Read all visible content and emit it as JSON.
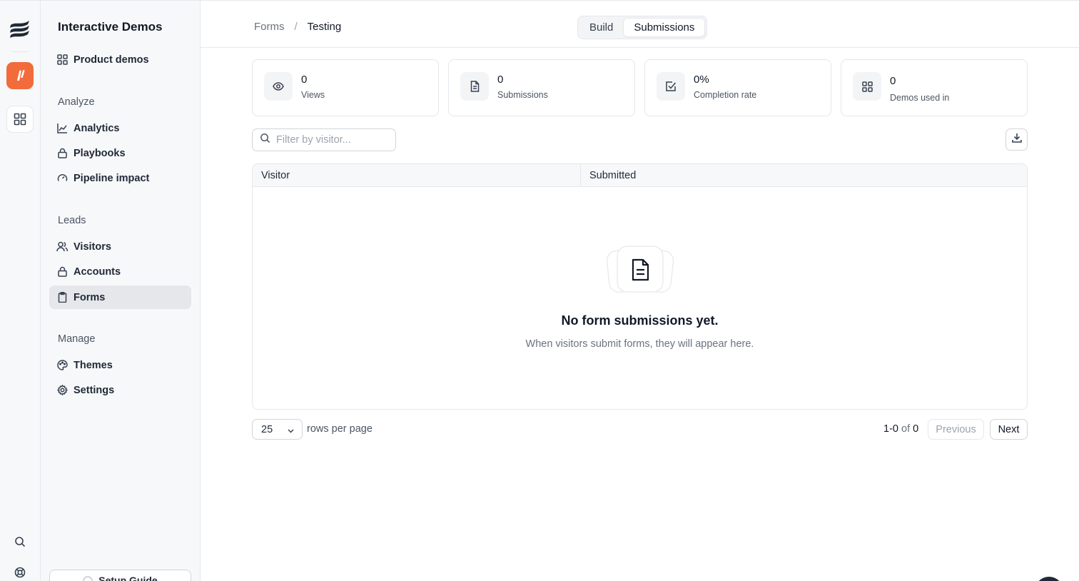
{
  "sidebar": {
    "title": "Interactive Demos",
    "product_demos": "Product demos",
    "sections": {
      "analyze": "Analyze",
      "leads": "Leads",
      "manage": "Manage"
    },
    "items": {
      "analytics": "Analytics",
      "playbooks": "Playbooks",
      "pipeline_impact": "Pipeline impact",
      "visitors": "Visitors",
      "accounts": "Accounts",
      "forms": "Forms",
      "themes": "Themes",
      "settings": "Settings"
    },
    "setup_guide": "Setup Guide"
  },
  "header": {
    "breadcrumb_parent": "Forms",
    "breadcrumb_separator": "/",
    "breadcrumb_current": "Testing",
    "tabs": {
      "build": "Build",
      "submissions": "Submissions"
    },
    "active_tab": "Submissions"
  },
  "stats": [
    {
      "value": "0",
      "label": "Views",
      "icon": "eye-icon"
    },
    {
      "value": "0",
      "label": "Submissions",
      "icon": "document-icon"
    },
    {
      "value": "0%",
      "label": "Completion rate",
      "icon": "check-square-icon"
    },
    {
      "value": "0",
      "label": "Demos used in",
      "icon": "grid-icon"
    }
  ],
  "filter": {
    "placeholder": "Filter by visitor...",
    "value": ""
  },
  "table": {
    "columns": [
      "Visitor",
      "Submitted"
    ],
    "empty_title": "No form submissions yet.",
    "empty_subtitle": "When visitors submit forms, they will appear here."
  },
  "pagination": {
    "rows_per_page_value": "25",
    "rows_per_page_label": "rows per page",
    "range": "1-0",
    "of_label": "of",
    "total": "0",
    "previous": "Previous",
    "next": "Next"
  },
  "colors": {
    "accent": "#f26b3a",
    "sidebar_bg": "#f7f8f9",
    "border": "#e5e7eb"
  }
}
